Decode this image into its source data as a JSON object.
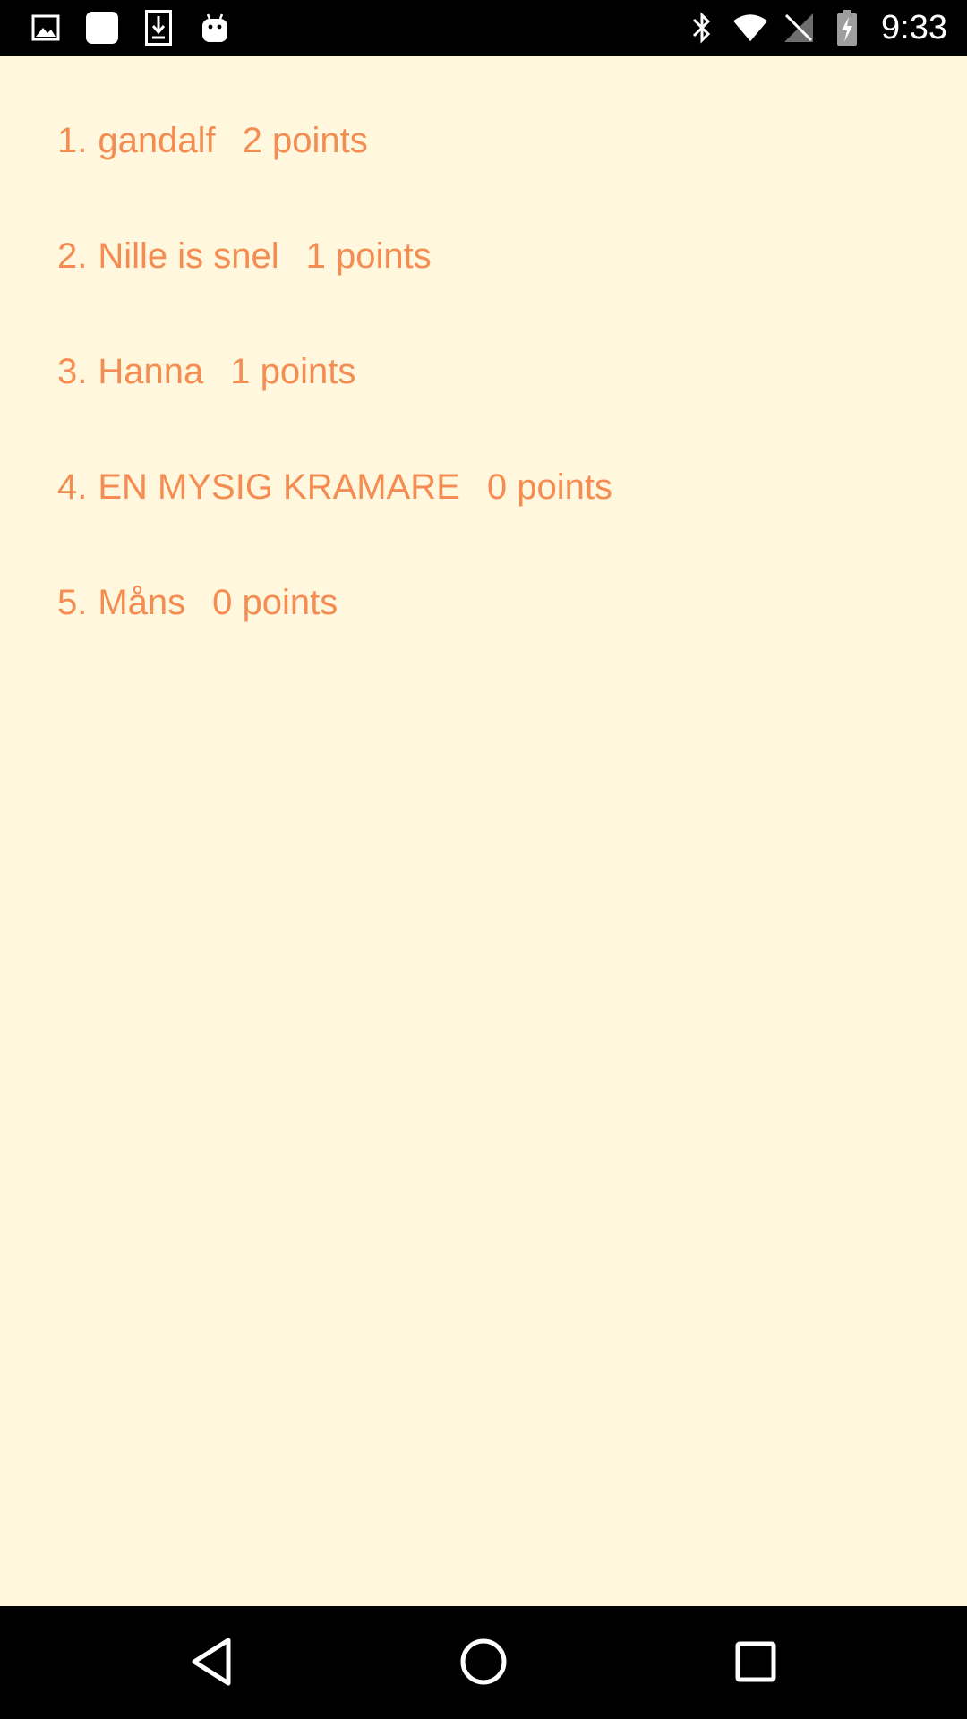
{
  "status_bar": {
    "left_icons": [
      "gallery-icon",
      "app-square-icon",
      "download-icon",
      "android-icon"
    ],
    "right_icons": [
      "bluetooth-icon",
      "wifi-icon",
      "no-signal-icon",
      "battery-charging-icon"
    ],
    "time": "9:33"
  },
  "scoreboard": {
    "entries": [
      {
        "rank": "1.",
        "name": "gandalf",
        "points": "2 points"
      },
      {
        "rank": "2.",
        "name": "Nille is snel",
        "points": "1 points"
      },
      {
        "rank": "3.",
        "name": "Hanna",
        "points": "1 points"
      },
      {
        "rank": "4.",
        "name": "EN MYSIG KRAMARE",
        "points": "0 points"
      },
      {
        "rank": "5.",
        "name": "Måns",
        "points": "0 points"
      }
    ]
  },
  "nav_bar": {
    "buttons": [
      "back-icon",
      "home-icon",
      "recents-icon"
    ]
  },
  "colors": {
    "background": "#FFF8DE",
    "text_accent": "#F58C52",
    "bars": "#000000"
  }
}
